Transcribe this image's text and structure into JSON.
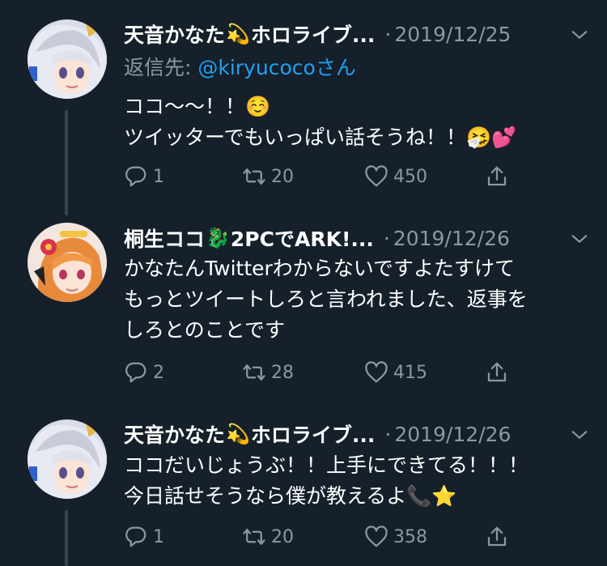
{
  "tweets": [
    {
      "author": "天音かなた💫ホロライブ...",
      "author_parts": [
        "天音かなた",
        "💫",
        "ホロライブ..."
      ],
      "date": "2019/12/25",
      "reply_prefix": "返信先: ",
      "reply_handle": "@kiryucoco",
      "reply_suffix": "さん",
      "lines": [
        "ココ〜〜！！☺️",
        "ツイッターでもいっぱい話そうね！！🤧💕"
      ],
      "reply_count": "1",
      "retweet_count": "20",
      "like_count": "450"
    },
    {
      "author": "桐生ココ🐉2PCでARK!...",
      "author_parts": [
        "桐生ココ",
        "🐉",
        "2PCでARK!..."
      ],
      "date": "2019/12/26",
      "lines": [
        "かなたんTwitterわからないですよたすけて",
        "もっとツイートしろと言われました、返事を",
        "しろとのことです"
      ],
      "reply_count": "2",
      "retweet_count": "28",
      "like_count": "415"
    },
    {
      "author": "天音かなた💫ホロライブ...",
      "author_parts": [
        "天音かなた",
        "💫",
        "ホロライブ..."
      ],
      "date": "2019/12/26",
      "lines": [
        "ココだいじょうぶ！！上手にできてる！！！",
        "今日話せそうなら僕が教えるよ📞⭐"
      ],
      "reply_count": "1",
      "retweet_count": "20",
      "like_count": "358"
    }
  ],
  "separator": "·",
  "colors": {
    "background": "#15202b",
    "secondary_text": "#8899a6",
    "link": "#1da1f2",
    "thread_line": "#38444d"
  }
}
